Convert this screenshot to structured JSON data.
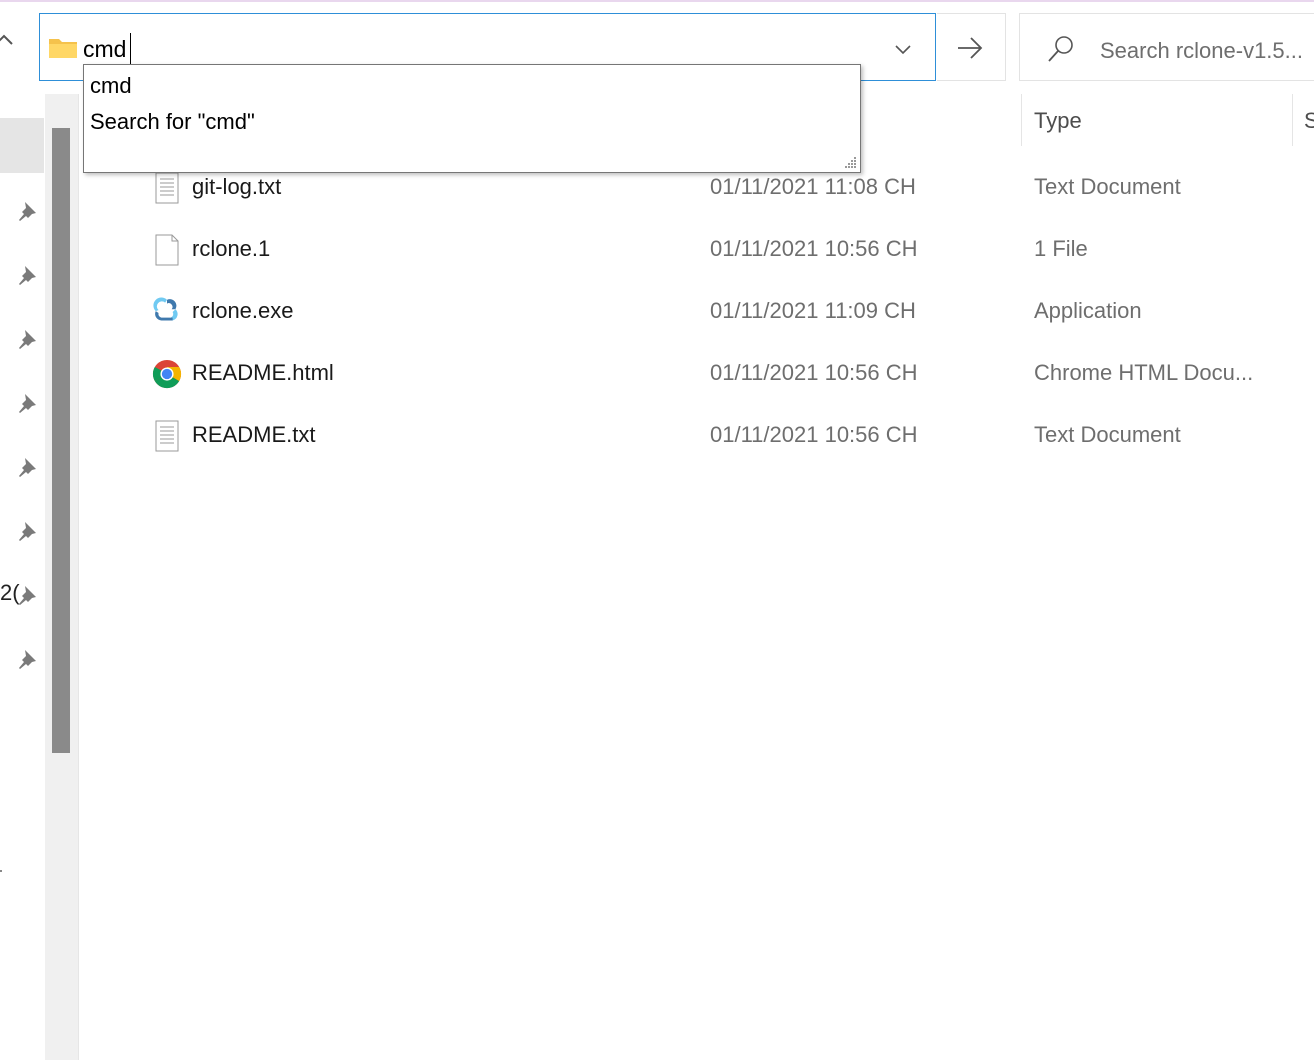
{
  "address_bar": {
    "value": "cmd"
  },
  "search": {
    "placeholder": "Search rclone-v1.5..."
  },
  "autocomplete": {
    "items": [
      "cmd",
      "Search for \"cmd\""
    ]
  },
  "columns": {
    "type": "Type",
    "size_partial": "S"
  },
  "files": [
    {
      "name": "git-log.txt",
      "date": "01/11/2021 11:08 CH",
      "type": "Text Document",
      "icon": "text-file-icon"
    },
    {
      "name": "rclone.1",
      "date": "01/11/2021 10:56 CH",
      "type": "1 File",
      "icon": "blank-file-icon"
    },
    {
      "name": "rclone.exe",
      "date": "01/11/2021 11:09 CH",
      "type": "Application",
      "icon": "rclone-app-icon"
    },
    {
      "name": "README.html",
      "date": "01/11/2021 10:56 CH",
      "type": "Chrome HTML Docu...",
      "icon": "chrome-icon"
    },
    {
      "name": "README.txt",
      "date": "01/11/2021 10:56 CH",
      "type": "Text Document",
      "icon": "text-file-icon"
    }
  ],
  "nav": {
    "cut_text": "2("
  },
  "colors": {
    "accent": "#2e8fd8",
    "selection": "#e5e5e5",
    "scrollbar_thumb": "#8a8a8a"
  }
}
